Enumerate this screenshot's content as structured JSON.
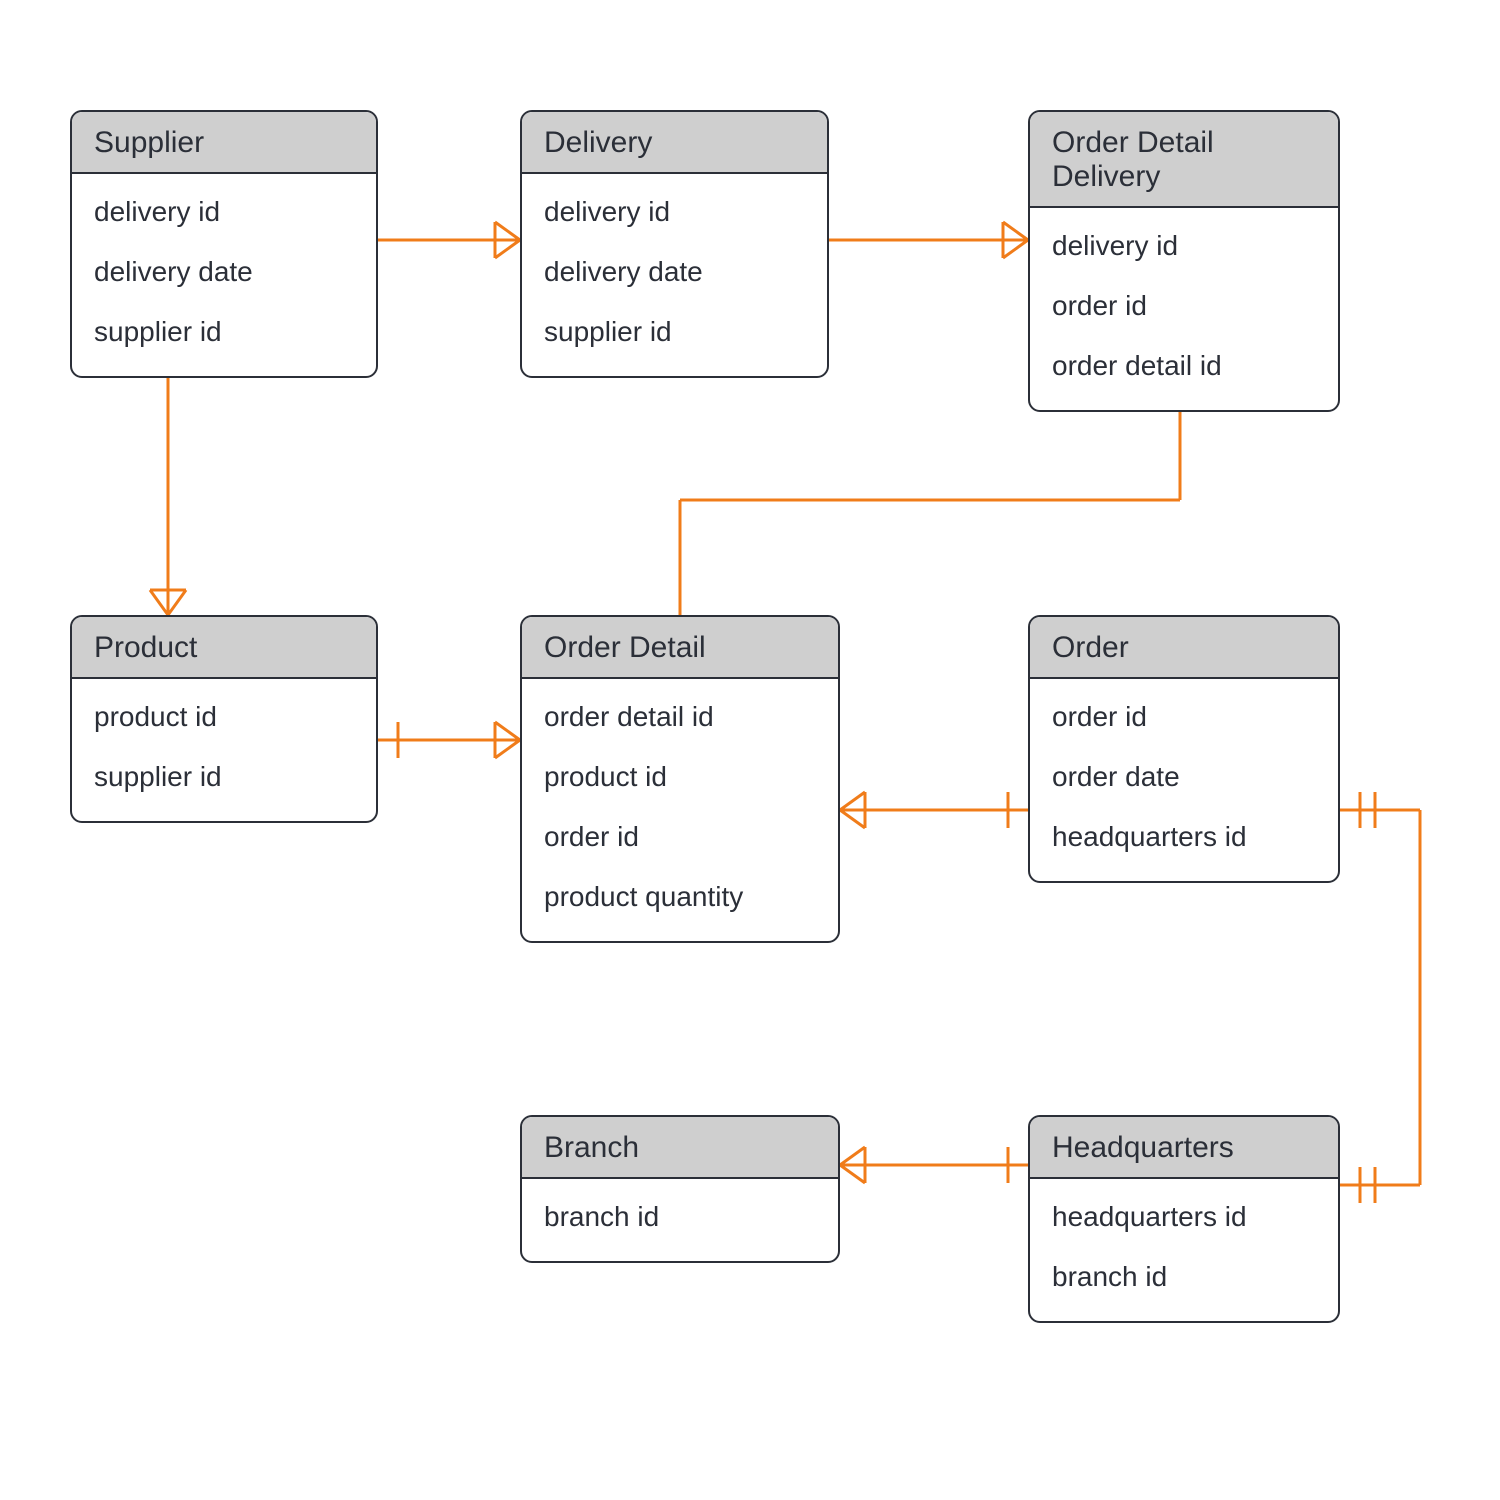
{
  "diagram_type": "entity-relationship",
  "colors": {
    "connector": "#f07c1a",
    "entity_border": "#2b2f38",
    "entity_header_bg": "#cfcfcf",
    "entity_body_bg": "#ffffff",
    "text": "#2b2f38"
  },
  "entities": {
    "supplier": {
      "title": "Supplier",
      "attrs": [
        "delivery id",
        "delivery date",
        "supplier id"
      ]
    },
    "delivery": {
      "title": "Delivery",
      "attrs": [
        "delivery id",
        "delivery date",
        "supplier id"
      ]
    },
    "order_detail_delivery": {
      "title": "Order Detail Delivery",
      "attrs": [
        "delivery id",
        "order id",
        "order detail id"
      ]
    },
    "product": {
      "title": "Product",
      "attrs": [
        "product id",
        "supplier id"
      ]
    },
    "order_detail": {
      "title": "Order Detail",
      "attrs": [
        "order detail id",
        "product id",
        "order id",
        "product quantity"
      ]
    },
    "order": {
      "title": "Order",
      "attrs": [
        "order id",
        "order date",
        "headquarters id"
      ]
    },
    "branch": {
      "title": "Branch",
      "attrs": [
        "branch id"
      ]
    },
    "headquarters": {
      "title": "Headquarters",
      "attrs": [
        "headquarters id",
        "branch id"
      ]
    }
  },
  "relationships": [
    {
      "from": "supplier",
      "to": "delivery",
      "from_card": "one",
      "to_card": "many"
    },
    {
      "from": "delivery",
      "to": "order_detail_delivery",
      "from_card": "one",
      "to_card": "many"
    },
    {
      "from": "supplier",
      "to": "product",
      "from_card": "one",
      "to_card": "many"
    },
    {
      "from": "product",
      "to": "order_detail",
      "from_card": "one",
      "to_card": "many"
    },
    {
      "from": "order",
      "to": "order_detail",
      "from_card": "one",
      "to_card": "many"
    },
    {
      "from": "order_detail",
      "to": "order_detail_delivery",
      "from_card": "one",
      "to_card": "many"
    },
    {
      "from": "order",
      "to": "headquarters",
      "from_card": "one-and-only-one",
      "to_card": "one-and-only-one"
    },
    {
      "from": "headquarters",
      "to": "branch",
      "from_card": "one",
      "to_card": "many"
    }
  ]
}
